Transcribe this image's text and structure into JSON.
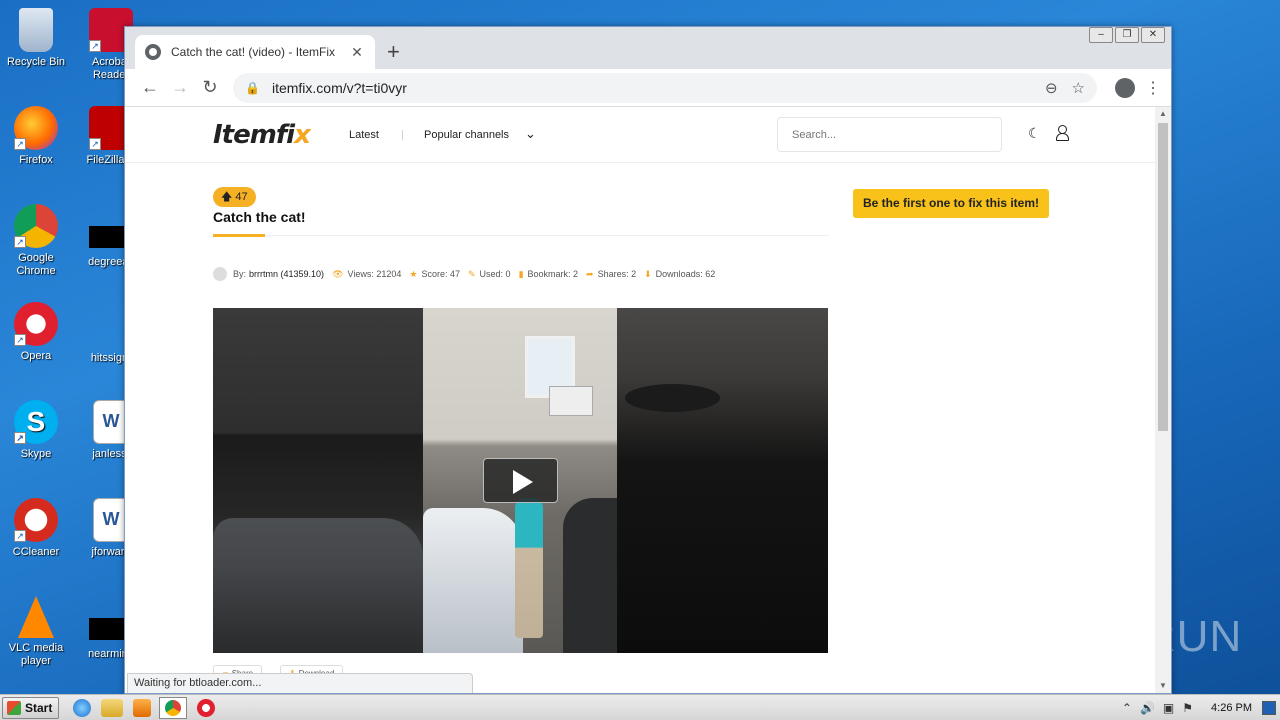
{
  "desktop": {
    "icons": [
      {
        "label": "Recycle Bin"
      },
      {
        "label": "Acrobat Reader"
      },
      {
        "label": "Firefox"
      },
      {
        "label": "FileZilla C"
      },
      {
        "label": "Google Chrome"
      },
      {
        "label": "degreeac"
      },
      {
        "label": "Opera"
      },
      {
        "label": "hitssign."
      },
      {
        "label": "Skype"
      },
      {
        "label": "janless."
      },
      {
        "label": "CCleaner"
      },
      {
        "label": "jforward"
      },
      {
        "label": "VLC media player"
      },
      {
        "label": "nearminu"
      }
    ],
    "watermark": "ANY RUN"
  },
  "browser": {
    "tab_title": "Catch the cat! (video) - ItemFix",
    "tab_close": "✕",
    "new_tab": "+",
    "url": "itemfix.com/v?t=ti0vyr",
    "status_text": "Waiting for btloader.com..."
  },
  "site": {
    "logo_text": "Itemfi",
    "logo_x": "x",
    "nav_latest": "Latest",
    "nav_sep": "|",
    "nav_popular": "Popular channels",
    "search_placeholder": "Search..."
  },
  "post": {
    "votes": "47",
    "title": "Catch the cat!",
    "fix_button": "Be the first one to fix this item!",
    "meta": {
      "by_label": "By:",
      "author": "brrrtmn (41359.10)",
      "views": "Views: 21204",
      "score": "Score: 47",
      "used": "Used: 0",
      "bookmark": "Bookmark: 2",
      "shares": "Shares: 2",
      "downloads": "Downloads: 62"
    },
    "share_label": "Share",
    "download_label": "Download"
  },
  "taskbar": {
    "start_label": "Start",
    "clock": "4:26 PM"
  }
}
